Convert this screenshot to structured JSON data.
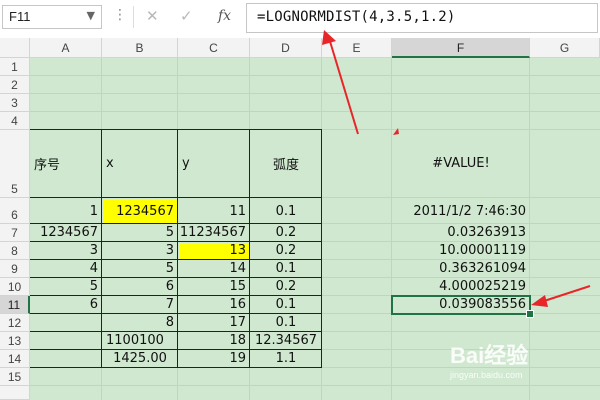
{
  "name_box": {
    "value": "F11"
  },
  "formula_bar": {
    "cancel_icon": "close-icon",
    "enter_icon": "check-icon",
    "function_label": "fx",
    "formula": "=LOGNORMDIST(4,3.5,1.2)"
  },
  "columns": [
    "A",
    "B",
    "C",
    "D",
    "E",
    "F",
    "G"
  ],
  "selected_column": "F",
  "rows": [
    "1",
    "2",
    "3",
    "4",
    "5",
    "6",
    "7",
    "8",
    "9",
    "10",
    "11",
    "12",
    "13",
    "14",
    "15"
  ],
  "selected_row": "11",
  "cells": {
    "A5": "序号",
    "B5": "x",
    "C5": "y",
    "D5": "弧度",
    "F5": "#VALUE!",
    "A6": "1",
    "B6": "1234567",
    "C6": "11",
    "D6": "0.1",
    "F6": "2011/1/2 7:46:30",
    "A7": "1234567",
    "B7": "5",
    "C7": "11234567",
    "D7": "0.2",
    "F7": "0.03263913",
    "A8": "3",
    "B8": "3",
    "C8": "13",
    "D8": "0.2",
    "F8": "10.00001119",
    "A9": "4",
    "B9": "5",
    "C9": "14",
    "D9": "0.1",
    "F9": "0.363261094",
    "A10": "5",
    "B10": "6",
    "C10": "15",
    "D10": "0.2",
    "F10": "4.000025219",
    "A11": "6",
    "B11": "7",
    "C11": "16",
    "D11": "0.1",
    "F11": "0.039083556",
    "B12": "8",
    "C12": "17",
    "D12": "0.1",
    "B13": "1100100",
    "C13": "18",
    "D13": "12.34567",
    "B14": "1425.00",
    "C14": "19",
    "D14": "1.1"
  },
  "highlight_color": "#ffff00",
  "grid_color": "#cfe8cf",
  "accent_color": "#217346",
  "annotation_color": "#e8262a",
  "watermark": {
    "brand": "Bai经验",
    "url": "jingyan.baidu.com"
  }
}
